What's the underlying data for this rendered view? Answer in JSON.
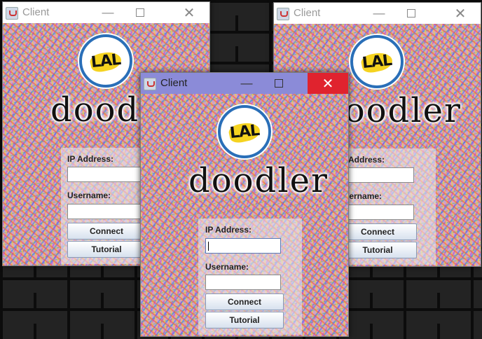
{
  "windows": [
    {
      "id": "back-left",
      "title": "Client",
      "active": false,
      "logo_text": "LAL",
      "app_name": "doodler",
      "ip_label": "IP Address:",
      "ip_value": "",
      "username_label": "Username:",
      "username_value": "",
      "connect_label": "Connect",
      "tutorial_label": "Tutorial"
    },
    {
      "id": "back-right",
      "title": "Client",
      "active": false,
      "logo_text": "LAL",
      "app_name": "doodler",
      "ip_label": "IP Address:",
      "ip_value": "",
      "username_label": "Username:",
      "username_value": "",
      "connect_label": "Connect",
      "tutorial_label": "Tutorial"
    },
    {
      "id": "front",
      "title": "Client",
      "active": true,
      "logo_text": "LAL",
      "app_name": "doodler",
      "ip_label": "IP Address:",
      "ip_value": "",
      "username_label": "Username:",
      "username_value": "",
      "connect_label": "Connect",
      "tutorial_label": "Tutorial"
    }
  ],
  "icons": {
    "app": "java-cup-icon",
    "minimize": "minimize-icon",
    "maximize": "maximize-icon",
    "close": "close-icon"
  },
  "colors": {
    "active_titlebar": "#8b8bd8",
    "close_hover": "#e0232e",
    "logo_ring": "#2a6fb8",
    "logo_fill": "#f5d320"
  },
  "glyphs": {
    "minimize": "—",
    "close": "✕"
  }
}
